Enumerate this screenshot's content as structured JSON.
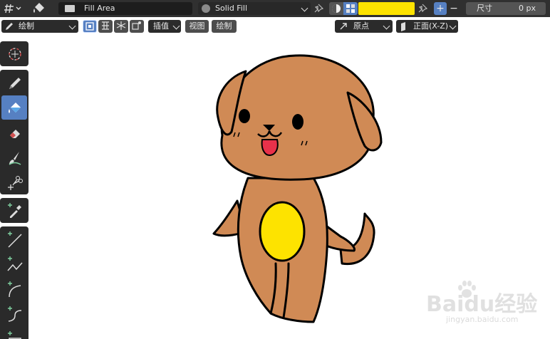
{
  "header": {
    "fill_area_label": "Fill Area",
    "material_label": "Solid Fill",
    "color_hex": "#fde300",
    "size_label": "尺寸",
    "size_value": "0 px",
    "plus": "+",
    "minus": "−"
  },
  "toolbar2": {
    "mode_label": "绘制",
    "interp_label": "插值",
    "view_label": "视图",
    "draw_label": "绘制",
    "origin_label": "原点",
    "plane_label": "正面(X-Z)"
  },
  "tools": [
    {
      "name": "cursor-tool",
      "icon": "cursor-icon"
    },
    {
      "name": "draw-tool",
      "icon": "pencil-icon"
    },
    {
      "name": "fill-tool",
      "icon": "bucket-icon"
    },
    {
      "name": "erase-tool",
      "icon": "eraser-icon"
    },
    {
      "name": "tint-tool",
      "icon": "brush-icon"
    },
    {
      "name": "cutter-tool",
      "icon": "scissors-icon"
    },
    {
      "name": "eyedropper-tool",
      "icon": "eyedropper-icon"
    },
    {
      "name": "line-tool",
      "icon": "line-icon"
    },
    {
      "name": "polyline-tool",
      "icon": "polyline-icon"
    },
    {
      "name": "arc-tool",
      "icon": "arc-icon"
    },
    {
      "name": "curve-tool",
      "icon": "curve-icon"
    },
    {
      "name": "box-tool",
      "icon": "box-icon"
    }
  ],
  "watermark": {
    "brand": "Baidu经验",
    "url": "jingyan.baidu.com"
  },
  "colors": {
    "dog_body": "#d08a55",
    "belly": "#fde300",
    "tongue": "#e8314a",
    "active_tool": "#5680c2"
  }
}
